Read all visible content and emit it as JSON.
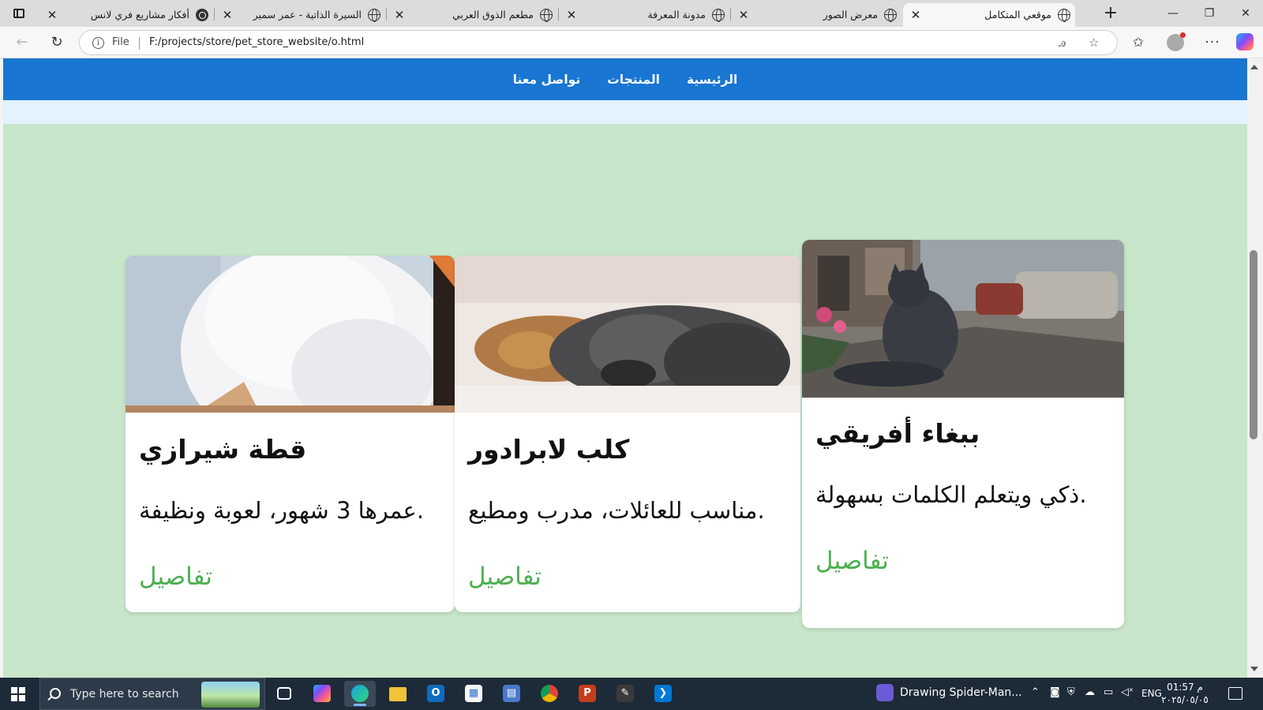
{
  "browser": {
    "tabs": [
      {
        "title": "موقعي المتكامل",
        "active": true
      },
      {
        "title": "معرض الصور",
        "active": false
      },
      {
        "title": "مدونة المعرفة",
        "active": false
      },
      {
        "title": "مطعم الذوق العربي",
        "active": false
      },
      {
        "title": "السيرة الذاتية - عمر سمير",
        "active": false
      },
      {
        "title": "أفكار مشاريع فري لانس",
        "active": false
      }
    ],
    "close_glyph": "✕",
    "new_tab_glyph": "+",
    "address": {
      "scheme_label": "File",
      "url": "F:/projects/store/pet_store_website/o.html"
    },
    "window_controls": {
      "minimize": "—",
      "restore": "❐",
      "close": "✕"
    }
  },
  "site": {
    "nav": [
      {
        "label": "الرئيسية"
      },
      {
        "label": "المنتجات"
      },
      {
        "label": "تواصل معنا"
      }
    ],
    "colors": {
      "header": "#1976d2",
      "subband": "#e3f2fd",
      "page_bg": "#c8e6c9",
      "link": "#4caf50"
    },
    "products": [
      {
        "title": "قطة شيرازي",
        "description": "عمرها 3 شهور، لعوبة ونظيفة.",
        "link": "تفاصيل",
        "image": "white-persian-cat-photo"
      },
      {
        "title": "كلب لابرادور",
        "description": "مناسب للعائلات، مدرب ومطيع.",
        "link": "تفاصيل",
        "image": "sleeping-dogs-photo"
      },
      {
        "title": "ببغاء أفريقي",
        "description": "ذكي ويتعلم الكلمات بسهولة.",
        "link": "تفاصيل",
        "image": "cat-statue-street-photo"
      }
    ]
  },
  "taskbar": {
    "search_placeholder": "Type here to search",
    "notification_app": "Drawing Spider-Man...",
    "language": "ENG",
    "time": "01:57 م",
    "date": "٢٠٢٥/٠٥/٠٥",
    "apps": [
      "task-view-icon",
      "copilot-icon",
      "edge-icon",
      "file-explorer-icon",
      "outlook-icon",
      "store-icon",
      "calculator-icon",
      "chrome-icon",
      "powerpoint-icon",
      "inkscape-icon",
      "vscode-icon"
    ]
  }
}
